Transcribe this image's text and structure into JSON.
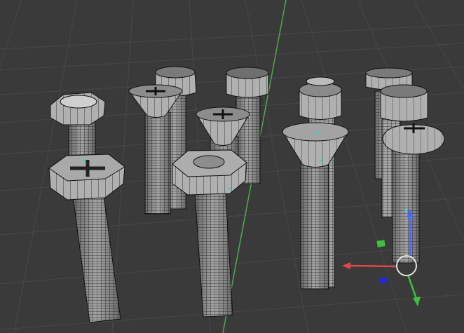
{
  "viewport": {
    "background": "#3a3a3a",
    "grid_color": "#4a4a4a",
    "y_axis_line_color": "#4fa84f"
  },
  "gizmo": {
    "x_axis_color": "#e0474c",
    "y_axis_color": "#3fbf3f",
    "z_axis_color": "#4a66ff",
    "pivot_ring_color": "#e0e0e0",
    "x_handle_color": "#2a2ac8",
    "y_handle_color": "#3fbf3f"
  },
  "models": {
    "mesh_fill": "#9a9a9a",
    "wire_color": "#1a1a1a",
    "count": 12,
    "head_types": [
      "hex",
      "countersunk-phillips",
      "socket-cap",
      "pan-head"
    ]
  }
}
